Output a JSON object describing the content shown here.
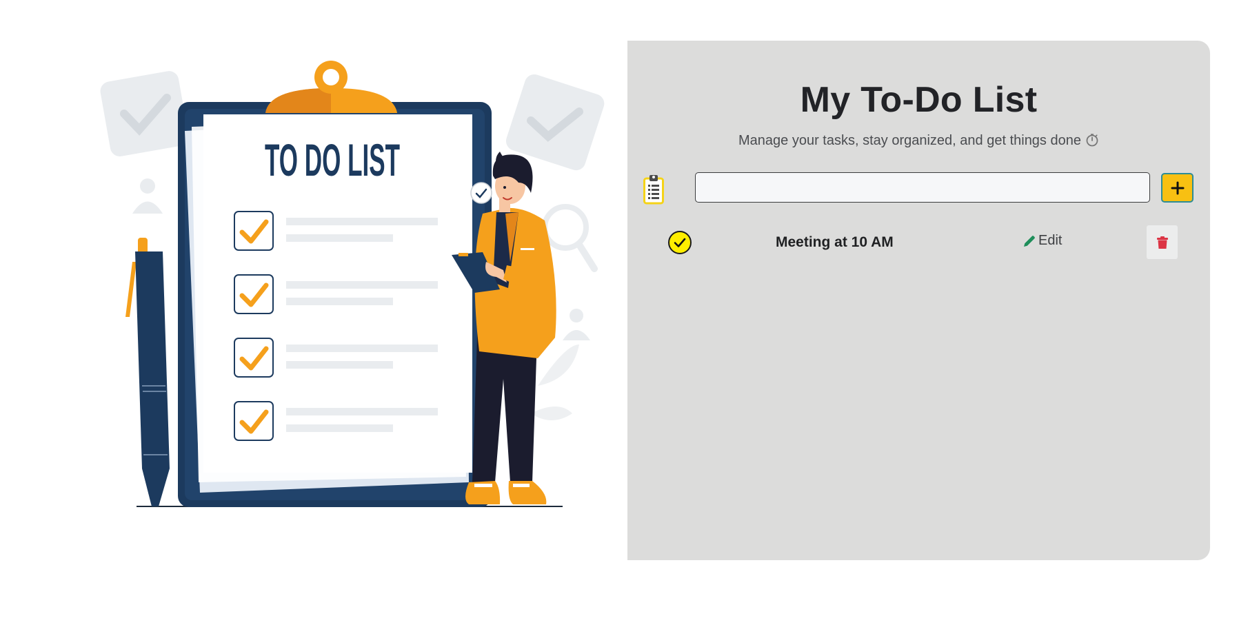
{
  "illustration": {
    "clipboard_heading": "TO DO LIST",
    "colors": {
      "navy": "#1c3a5e",
      "orange": "#f5a01c",
      "paper": "#ffffff",
      "ghost": "#e9ecef"
    }
  },
  "panel": {
    "title": "My To-Do List",
    "subtitle": "Manage your tasks, stay organized, and get things done",
    "subtitle_icon": "stopwatch-icon",
    "background": "#dcdcdb"
  },
  "input": {
    "value": "",
    "placeholder": "",
    "leading_icon": "clipboard-list-icon",
    "add_icon": "plus-icon",
    "add_color": "#f8c012"
  },
  "tasks": [
    {
      "text": "Meeting at 10 AM",
      "done": true,
      "check_icon": "check-circle-icon",
      "edit_label": "Edit",
      "edit_icon": "pencil-icon",
      "delete_icon": "trash-icon"
    }
  ],
  "colors": {
    "check_fill": "#ffee00",
    "edit_icon": "#1e8e5a",
    "delete_icon": "#dc3545"
  }
}
